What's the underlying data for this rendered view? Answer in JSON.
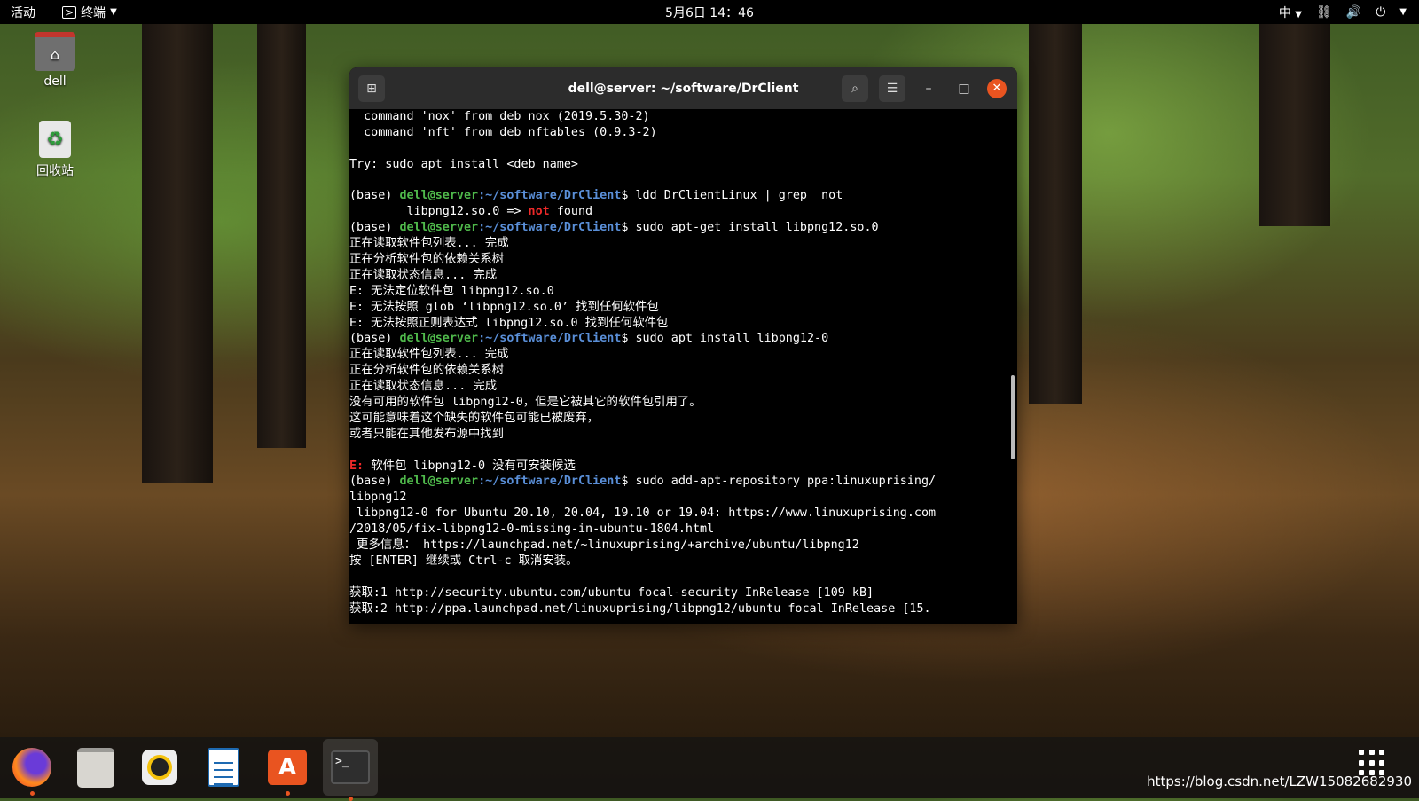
{
  "topbar": {
    "activities": "活动",
    "app_name": "终端",
    "clock": "5月6日 14：46",
    "input_method": "中"
  },
  "desktop": {
    "home_label": "dell",
    "trash_label": "回收站"
  },
  "terminal": {
    "title": "dell@server: ~/software/DrClient",
    "prompt_base": "(base) ",
    "prompt_user": "dell@server",
    "prompt_path": ":~/software/DrClient",
    "lines": {
      "l1": "  command 'nox' from deb nox (2019.5.30-2)",
      "l2": "  command 'nft' from deb nftables (0.9.3-2)",
      "l3": "",
      "l4": "Try: sudo apt install <deb name>",
      "l5": "",
      "cmd1": "$ ldd DrClientLinux | grep  not",
      "l7a": "        libpng12.so.0 => ",
      "l7b": "not",
      "l7c": " found",
      "cmd2": "$ sudo apt-get install libpng12.so.0",
      "l9": "正在读取软件包列表... 完成",
      "l10": "正在分析软件包的依赖关系树",
      "l11": "正在读取状态信息... 完成",
      "l12": "E: 无法定位软件包 libpng12.so.0",
      "l13": "E: 无法按照 glob ‘libpng12.so.0’ 找到任何软件包",
      "l14": "E: 无法按照正则表达式 libpng12.so.0 找到任何软件包",
      "cmd3": "$ sudo apt install libpng12-0",
      "l16": "正在读取软件包列表... 完成",
      "l17": "正在分析软件包的依赖关系树",
      "l18": "正在读取状态信息... 完成",
      "l19": "没有可用的软件包 libpng12-0，但是它被其它的软件包引用了。",
      "l20": "这可能意味着这个缺失的软件包可能已被废弃，",
      "l21": "或者只能在其他发布源中找到",
      "l22": "",
      "l23a": "E: ",
      "l23b": "软件包 libpng12-0 没有可安装候选",
      "cmd4": "$ sudo add-apt-repository ppa:linuxuprising/",
      "l25": "libpng12",
      "l26": " libpng12-0 for Ubuntu 20.10, 20.04, 19.10 or 19.04: https://www.linuxuprising.com",
      "l27": "/2018/05/fix-libpng12-0-missing-in-ubuntu-1804.html",
      "l28": " 更多信息： https://launchpad.net/~linuxuprising/+archive/ubuntu/libpng12",
      "l29": "按 [ENTER] 继续或 Ctrl-c 取消安装。",
      "l30": "",
      "l31": "获取:1 http://security.ubuntu.com/ubuntu focal-security InRelease [109 kB]",
      "l32": "获取:2 http://ppa.launchpad.net/linuxuprising/libpng12/ubuntu focal InRelease [15."
    }
  },
  "dock": {
    "apps": [
      "firefox-icon",
      "files-icon",
      "rhythmbox-icon",
      "writer-icon",
      "software-icon",
      "terminal-icon"
    ]
  },
  "watermark": "https://blog.csdn.net/LZW15082682930",
  "colors": {
    "accent": "#e95420",
    "prompt_user": "#4fb94b",
    "prompt_path": "#5a8fd8",
    "error": "#ef2929"
  }
}
